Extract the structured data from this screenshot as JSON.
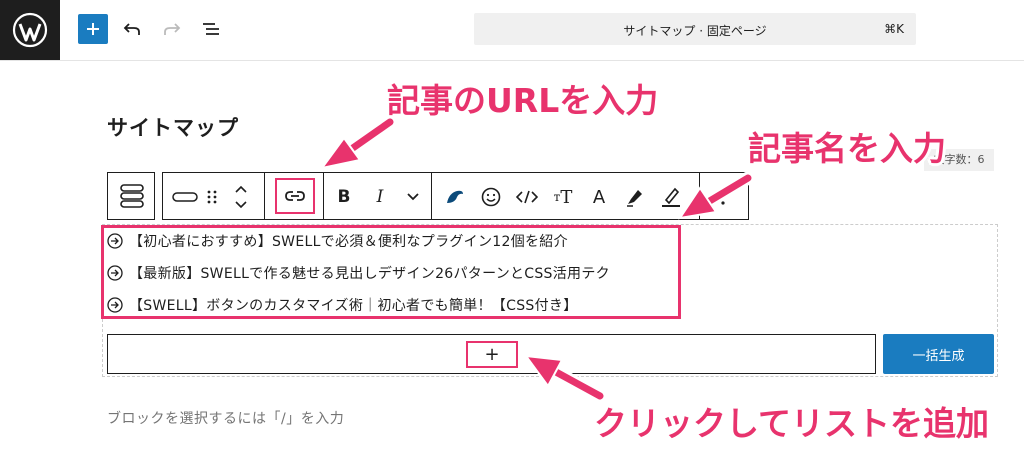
{
  "topbar": {
    "logo_icon": "wordpress-logo",
    "add_icon": "plus-icon",
    "undo_icon": "undo-icon",
    "redo_icon": "redo-icon",
    "list_view_icon": "list-view-icon",
    "command_title": "サイトマップ · 固定ページ",
    "command_shortcut": "⌘K"
  },
  "editor": {
    "page_title": "サイトマップ",
    "char_count": "文字数：6",
    "placeholder": "ブロックを選択するには「/」を入力"
  },
  "block_toolbar": {
    "block_type_icon": "list-block-icon",
    "tools": {
      "bold": "B",
      "italic": "I",
      "text_size": "T",
      "highlight": "A"
    }
  },
  "list": {
    "item_icon": "arrow-circle-right-icon",
    "items": [
      "【初心者におすすめ】SWELLで必須＆便利なプラグイン12個を紹介",
      "【最新版】SWELLで作る魅せる見出しデザイン26パターンとCSS活用テク",
      "【SWELL】ボタンのカスタマイズ術｜初心者でも簡単！【CSS付き】"
    ],
    "append_label": "+",
    "generate_label": "一括生成"
  },
  "annotations": {
    "url_callout": "記事のURLを入力",
    "title_callout": "記事名を入力",
    "add_callout": "クリックしてリストを追加",
    "color": "#e8336d"
  },
  "colors": {
    "accent": "#1a7cc0",
    "highlight": "#e8336d",
    "dark": "#1e1e1e"
  }
}
